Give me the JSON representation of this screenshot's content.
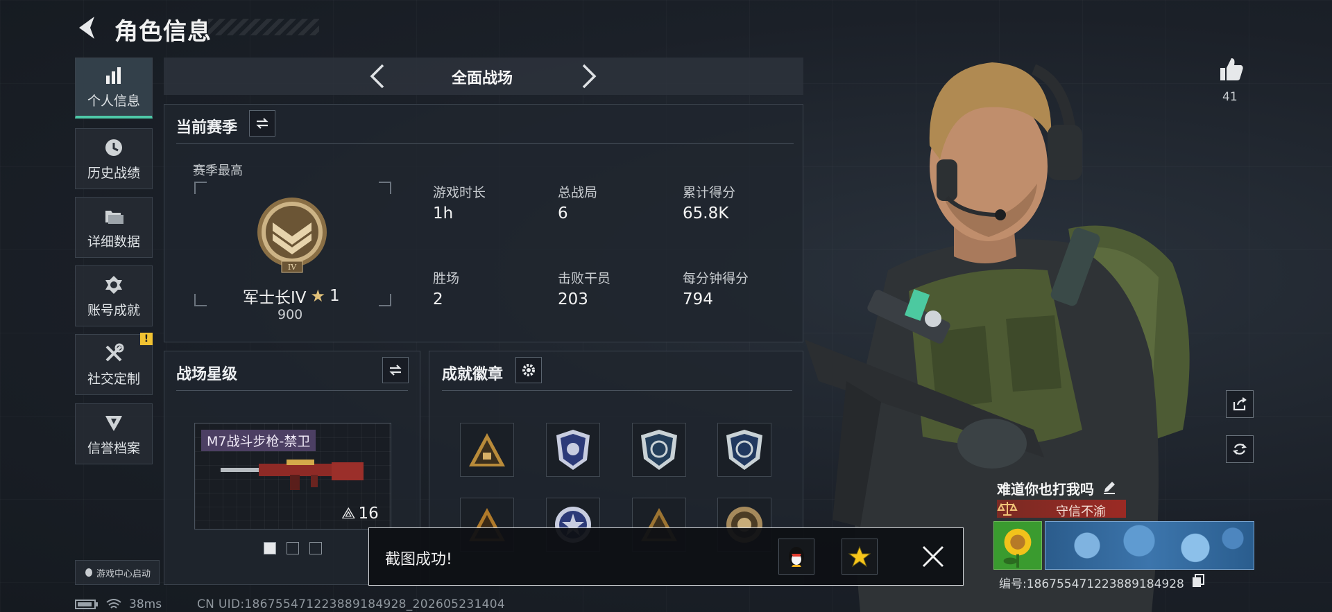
{
  "header": {
    "title": "角色信息"
  },
  "sidebar": {
    "items": [
      {
        "label": "个人信息",
        "icon": "bar-chart-icon",
        "active": true
      },
      {
        "label": "历史战绩",
        "icon": "clock-icon",
        "active": false
      },
      {
        "label": "详细数据",
        "icon": "folder-icon",
        "active": false
      },
      {
        "label": "账号成就",
        "icon": "medal-icon",
        "active": false
      },
      {
        "label": "社交定制",
        "icon": "tools-icon",
        "active": false,
        "alert": "!"
      },
      {
        "label": "信誉档案",
        "icon": "emblem-icon",
        "active": false
      }
    ],
    "game_center": "游戏中心启动"
  },
  "mode": {
    "title": "全面战场"
  },
  "season": {
    "title": "当前赛季",
    "best_label": "赛季最高",
    "rank_name": "军士长IV",
    "rank_stars": "1",
    "rank_points": "900",
    "rank_numeral": "IV",
    "stats": [
      {
        "label": "游戏时长",
        "value": "1h"
      },
      {
        "label": "总战局",
        "value": "6"
      },
      {
        "label": "累计得分",
        "value": "65.8K"
      },
      {
        "label": "胜场",
        "value": "2"
      },
      {
        "label": "击败干员",
        "value": "203"
      },
      {
        "label": "每分钟得分",
        "value": "794"
      }
    ]
  },
  "battle_stars": {
    "title": "战场星级",
    "weapon_name": "M7战斗步枪-禁卫",
    "weapon_level": "16",
    "pages": 3,
    "current_page": 1
  },
  "achievements": {
    "title": "成就徽章"
  },
  "toast": {
    "message": "截图成功!"
  },
  "likes": {
    "count": "41"
  },
  "profile": {
    "nickname": "难道你也打我吗",
    "honor": "守信不渝",
    "id_text": "编号:18675547122388918492​8"
  },
  "footer": {
    "latency": "38ms",
    "uid": "CN UID:18675547122388918492​8_202605231404"
  },
  "colors": {
    "accent": "#4ec9a8",
    "warning": "#f1c232",
    "honor": "#9b2a24"
  }
}
